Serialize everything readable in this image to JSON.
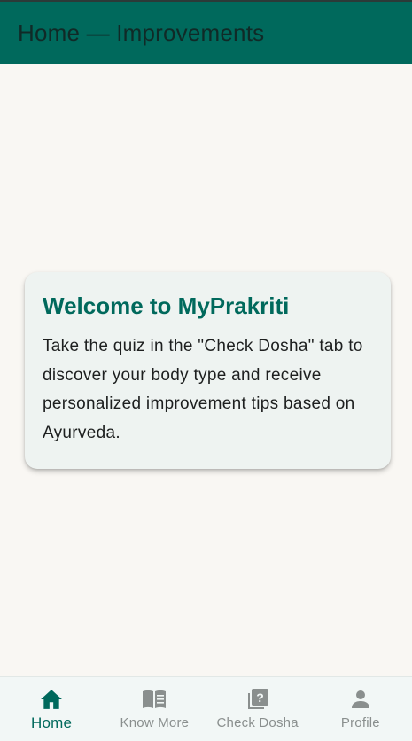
{
  "appbar": {
    "title": "Home — Improvements"
  },
  "card": {
    "title": "Welcome to MyPrakriti",
    "body": "Take the quiz in the \"Check Dosha\" tab to discover your body type and receive personalized improvement tips based on Ayurveda."
  },
  "bottom_nav": {
    "items": [
      {
        "label": "Home",
        "icon": "home-icon",
        "active": true
      },
      {
        "label": "Know More",
        "icon": "book-icon",
        "active": false
      },
      {
        "label": "Check Dosha",
        "icon": "quiz-icon",
        "active": false
      },
      {
        "label": "Profile",
        "icon": "person-icon",
        "active": false
      }
    ]
  },
  "colors": {
    "primary": "#00695c",
    "background": "#f9f7f3",
    "card": "#eef3f1",
    "inactive": "#8a8f8e"
  }
}
